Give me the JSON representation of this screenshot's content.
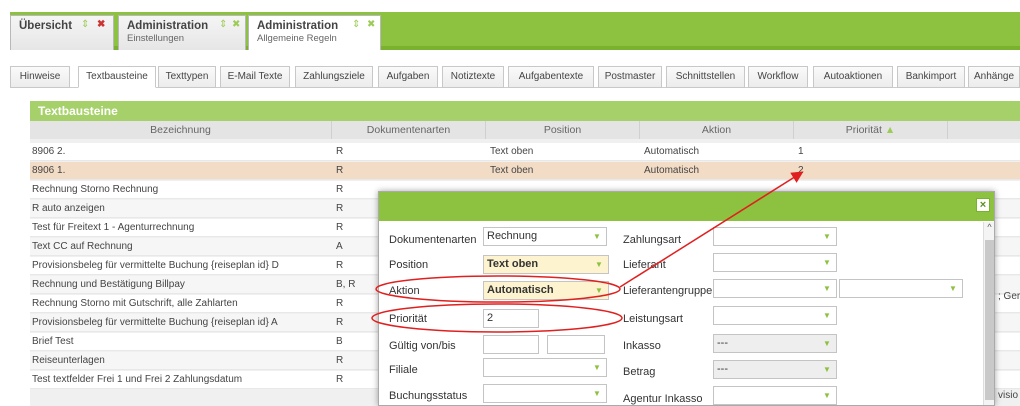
{
  "main_tabs": [
    {
      "line1": "Übersicht",
      "line2": ""
    },
    {
      "line1": "Administration",
      "line2": "Einstellungen"
    },
    {
      "line1": "Administration",
      "line2": "Allgemeine Regeln"
    }
  ],
  "sub_tabs": [
    "Hinweise",
    "Textbausteine",
    "Texttypen",
    "E-Mail Texte",
    "Zahlungsziele",
    "Aufgaben",
    "Notiztexte",
    "Aufgabentexte",
    "Postmaster",
    "Schnittstellen",
    "Workflow",
    "Autoaktionen",
    "Bankimport",
    "Anhänge"
  ],
  "panel": {
    "title": "Textbausteine",
    "columns": [
      "Bezeichnung",
      "Dokumentenarten",
      "Position",
      "Aktion",
      "Priorität"
    ],
    "sort_glyph": "▲",
    "rows": [
      {
        "name": "8906 2.",
        "doc": "R",
        "pos": "Text oben",
        "aktion": "Automatisch",
        "prio": "1"
      },
      {
        "name": "8906 1.",
        "doc": "R",
        "pos": "Text oben",
        "aktion": "Automatisch",
        "prio": "2"
      },
      {
        "name": "Rechnung Storno Rechnung",
        "doc": "R"
      },
      {
        "name": "R auto anzeigen",
        "doc": "R"
      },
      {
        "name": "Test für Freitext 1 - Agenturrechnung",
        "doc": "R"
      },
      {
        "name": "Text CC auf Rechnung",
        "doc": "A"
      },
      {
        "name": "Provisionsbeleg für vermittelte Buchung {reiseplan id} D",
        "doc": "R"
      },
      {
        "name": "Rechnung und Bestätigung Billpay",
        "doc": "B, R"
      },
      {
        "name": "Rechnung Storno mit Gutschrift, alle Zahlarten",
        "doc": "R"
      },
      {
        "name": "Provisionsbeleg für vermittelte Buchung {reiseplan id} A",
        "doc": "R"
      },
      {
        "name": "Brief Test",
        "doc": "B"
      },
      {
        "name": "Reiseunterlagen",
        "doc": "R"
      },
      {
        "name": "Test textfelder Frei 1 und Frei 2 Zahlungsdatum",
        "doc": "R"
      }
    ],
    "side_text_1": "; Ger",
    "side_text_2": "visio"
  },
  "dialog": {
    "close": "×",
    "dokumentenarten_label": "Dokumentenarten",
    "dokumentenarten_value": "Rechnung",
    "position_label": "Position",
    "position_value": "Text oben",
    "aktion_label": "Aktion",
    "aktion_value": "Automatisch",
    "prioritaet_label": "Priorität",
    "prioritaet_value": "2",
    "gueltig_label": "Gültig von/bis",
    "filiale_label": "Filiale",
    "buchungsstatus_label": "Buchungsstatus",
    "zahlungsart_label": "Zahlungsart",
    "lieferant_label": "Lieferant",
    "lieferantengruppe_label": "Lieferantengruppe",
    "leistungsart_label": "Leistungsart",
    "inkasso_label": "Inkasso",
    "inkasso_value": "---",
    "betrag_label": "Betrag",
    "betrag_value": "---",
    "agentur_inkasso_label": "Agentur Inkasso"
  },
  "icons": {
    "pin": "⇕",
    "close": "✖",
    "dropdown": "▼",
    "scroll_up": "^"
  },
  "colors": {
    "accent_green": "#8cc23f",
    "annotation_red": "#e0201f",
    "selected_row": "#f3dcc5"
  }
}
